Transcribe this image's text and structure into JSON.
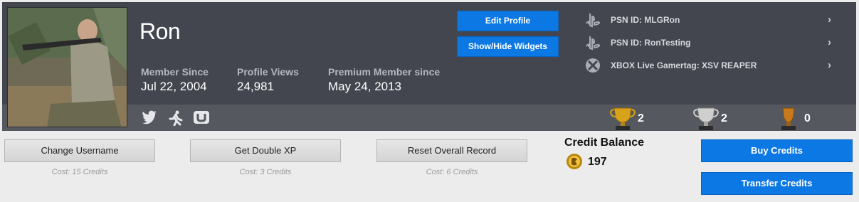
{
  "profile": {
    "username": "Ron",
    "stats": [
      {
        "label": "Member Since",
        "value": "Jul 22, 2004"
      },
      {
        "label": "Profile Views",
        "value": "24,981"
      },
      {
        "label": "Premium Member since",
        "value": "May 24, 2013"
      }
    ]
  },
  "actions": {
    "edit_profile": "Edit Profile",
    "show_hide_widgets": "Show/Hide Widgets"
  },
  "accounts": [
    {
      "icon": "playstation-icon",
      "text": "PSN ID: MLGRon"
    },
    {
      "icon": "playstation-icon",
      "text": "PSN ID: RonTesting"
    },
    {
      "icon": "xbox-icon",
      "text": "XBOX Live Gamertag: XSV REAPER"
    }
  ],
  "social": [
    "twitter-icon",
    "runner-icon",
    "wii-u-icon"
  ],
  "trophies": [
    {
      "place": "1st",
      "count": "2",
      "color": "#d9a21b"
    },
    {
      "place": "2nd",
      "count": "2",
      "color": "#c8c8c8"
    },
    {
      "place": "3rd",
      "count": "0",
      "color": "#c67a1c"
    }
  ],
  "purchases": [
    {
      "label": "Change Username",
      "cost": "Cost: 15 Credits"
    },
    {
      "label": "Get Double XP",
      "cost": "Cost: 3 Credits"
    },
    {
      "label": "Reset Overall Record",
      "cost": "Cost: 6 Credits"
    }
  ],
  "credits": {
    "title": "Credit Balance",
    "balance": "197",
    "buy": "Buy Credits",
    "transfer": "Transfer Credits"
  },
  "colors": {
    "header": "#43464f",
    "header_bottom": "#55585f",
    "accent": "#0c78e3"
  }
}
